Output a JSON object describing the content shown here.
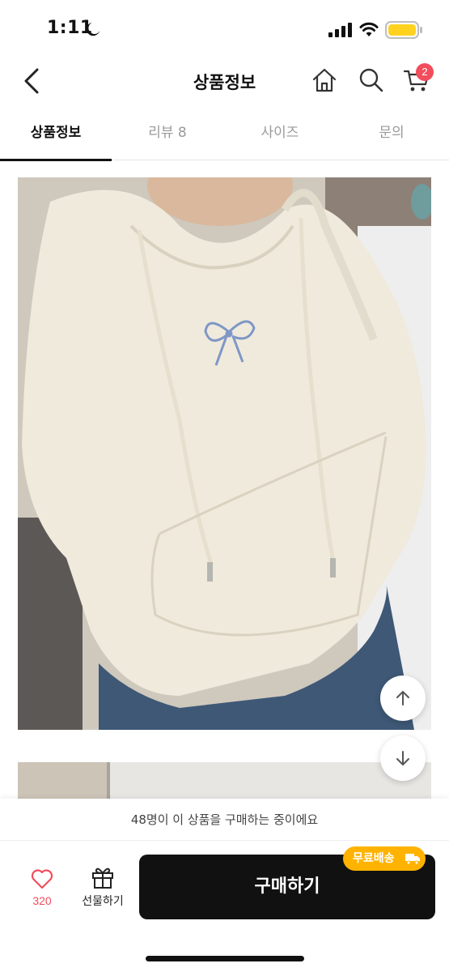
{
  "status_bar": {
    "time": "1:11"
  },
  "header": {
    "title": "상품정보",
    "cart_count": "2"
  },
  "tabs": [
    {
      "label": "상품정보",
      "active": true
    },
    {
      "label": "리뷰 8",
      "active": false
    },
    {
      "label": "사이즈",
      "active": false
    },
    {
      "label": "문의",
      "active": false
    }
  ],
  "bottom": {
    "notice": "48명이 이 상품을 구매하는 중이에요",
    "like_count": "320",
    "gift_label": "선물하기",
    "buy_label": "구매하기",
    "free_shipping_label": "무료배송"
  },
  "colors": {
    "accent": "#f24d5c",
    "badge_yellow": "#ffb300",
    "buy_button": "#111111"
  }
}
